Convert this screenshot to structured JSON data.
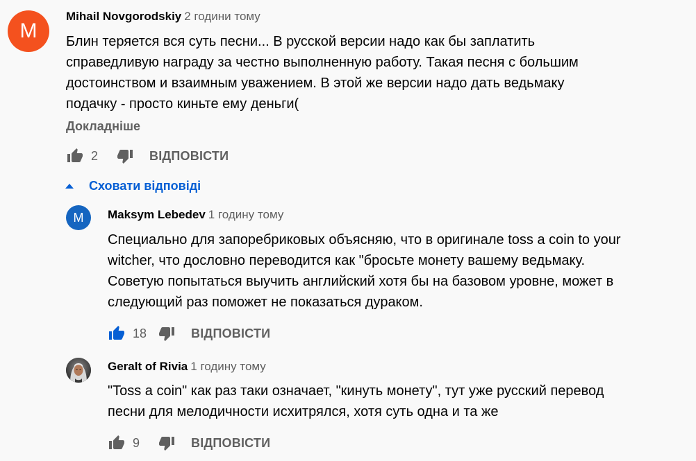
{
  "comments": [
    {
      "avatar_letter": "M",
      "avatar_color": "#f4511e",
      "author": "Mihail Novgorodskiy",
      "time": "2 години тому",
      "lines": [
        "Блин теряется вся суть песни... В русской версии надо как бы заплатить",
        "справедливую награду за честно выполненную работу. Такая песня с большим",
        "достоинством и взаимным уважением. В этой же версии надо дать ведьмаку",
        "подачку - просто киньте ему деньги("
      ],
      "more_label": "Докладніше",
      "likes": "2",
      "reply_label": "ВІДПОВІСТИ",
      "liked": false
    }
  ],
  "replies_toggle": {
    "label": "Сховати відповіді",
    "icon": "chevron-up-icon",
    "color": "#065fd4"
  },
  "replies": [
    {
      "avatar_letter": "M",
      "avatar_color": "#1565c0",
      "author": "Maksym Lebedev",
      "time": "1 годину тому",
      "lines": [
        "Специально для запоребриковых объясняю, что в оригинале toss a coin to your",
        "witcher, что дословно переводится как \"бросьте монету вашему ведьмаку.",
        "Советую попытаться выучить английский хотя бы на базовом уровне, может в",
        "следующий раз поможет не показаться дураком."
      ],
      "likes": "18",
      "reply_label": "ВІДПОВІСТИ",
      "liked": true
    },
    {
      "avatar_letter": "",
      "avatar_color": "#5a5a5a",
      "author": "Geralt of Rivia",
      "time": "1 годину тому",
      "lines": [
        "\"Toss a coin\" как раз таки означает, \"кинуть монету\", тут уже русский перевод",
        "песни для мелодичности исхитрялся, хотя суть одна и та же"
      ],
      "likes": "9",
      "reply_label": "ВІДПОВІСТИ",
      "liked": false
    }
  ],
  "colors": {
    "text_primary": "#030303",
    "text_secondary": "#606060",
    "link_blue": "#065fd4",
    "liked_blue": "#065fd4",
    "background": "#f9f9f9"
  }
}
